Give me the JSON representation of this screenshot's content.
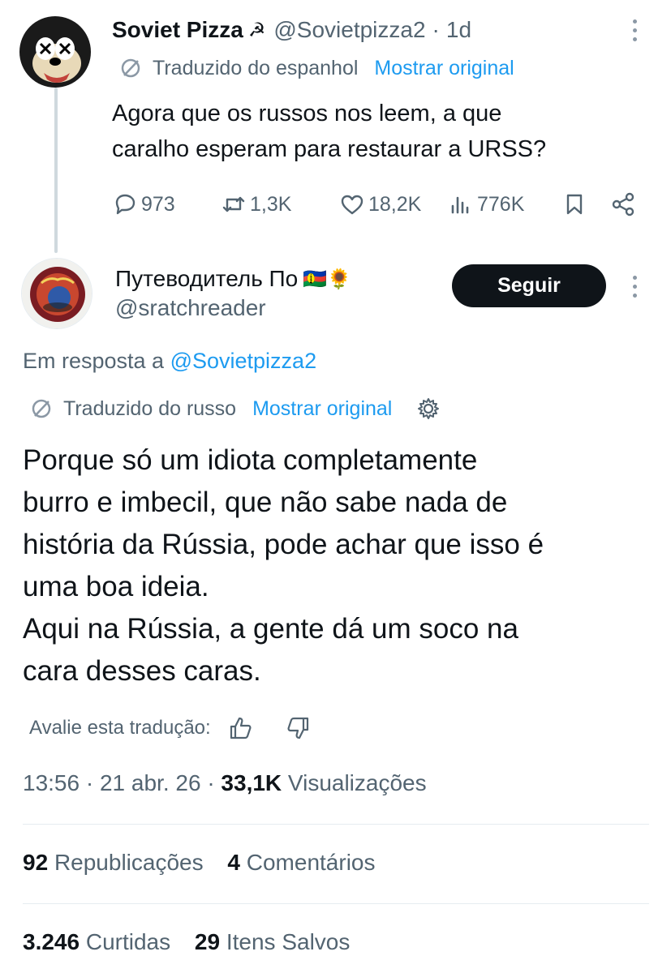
{
  "parent_tweet": {
    "display_name": "Soviet Pizza",
    "name_emoji": "☭",
    "handle": "@Sovietpizza2",
    "time_sep": "·",
    "time_ago": "1d",
    "translated_label": "Traduzido do espanhol",
    "show_original": "Mostrar original",
    "text_line1": "Agora que os russos nos leem, a que",
    "text_line2": "caralho esperam para restaurar a URSS?",
    "replies": "973",
    "retweets": "1,3K",
    "likes": "18,2K",
    "views": "776K"
  },
  "main_tweet": {
    "display_name": "Путеводитель По",
    "name_emoji": "🇳🇨🌻",
    "handle": "@sratchreader",
    "follow_label": "Seguir",
    "reply_prefix": "Em resposta a",
    "reply_handle": "@Sovietpizza2",
    "translated_label": "Traduzido do russo",
    "show_original": "Mostrar original",
    "text_lines": [
      "Porque só um idiota completamente",
      "burro e imbecil, que não sabe nada de",
      "história da Rússia, pode achar que isso é",
      "uma boa ideia.",
      "Aqui na Rússia, a gente dá um soco na",
      "cara desses caras."
    ],
    "rate_label": "Avalie esta tradução:",
    "time": "13:56",
    "date": "21 abr. 26",
    "sep": "·",
    "views_count": "33,1K",
    "views_label": "Visualizações",
    "reposts_count": "92",
    "reposts_label": "Republicações",
    "comments_count": "4",
    "comments_label": "Comentários",
    "likes_count": "3.246",
    "likes_label": "Curtidas",
    "saves_count": "29",
    "saves_label": "Itens Salvos"
  },
  "colors": {
    "accent": "#1d9bf0",
    "text": "#0f1419",
    "muted": "#536471",
    "button_bg": "#0f1419"
  },
  "icons": [
    "translate-icon",
    "reply-icon",
    "retweet-icon",
    "like-icon",
    "views-icon",
    "bookmark-icon",
    "share-icon",
    "more-icon",
    "settings-icon",
    "thumbs-up-icon",
    "thumbs-down-icon"
  ]
}
